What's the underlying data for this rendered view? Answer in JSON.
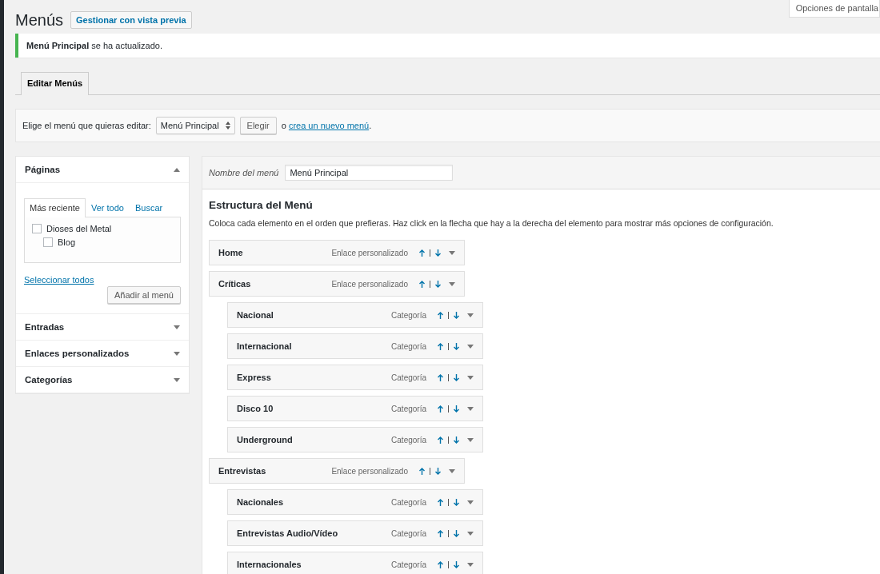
{
  "page_title": "Menús",
  "preview_button": "Gestionar con vista previa",
  "screen_options": "Opciones de pantalla",
  "notice": "**Menú Principal** se ha actualizado.",
  "tabs": [
    {
      "label": "Editar Menús",
      "selected": true
    }
  ],
  "menu_select": {
    "label": "Elige el menú que quieras editar:",
    "value": "Menú Principal",
    "button": "Elegir",
    "create_prefix": "o",
    "create_link": "crea un nuevo menú",
    "create_suffix": "."
  },
  "sidebar": {
    "panels": [
      {
        "title": "Páginas",
        "expanded": true,
        "tabs": [
          {
            "label": "Más reciente",
            "selected": true
          },
          {
            "label": "Ver todo",
            "selected": false
          },
          {
            "label": "Buscar",
            "selected": false
          }
        ],
        "items": [
          {
            "label": "Dioses del Metal",
            "checked": false,
            "children": [
              {
                "label": "Blog",
                "checked": false
              }
            ]
          }
        ],
        "select_all": "Seleccionar todos",
        "add_button": "Añadir al menú"
      },
      {
        "title": "Entradas",
        "expanded": false
      },
      {
        "title": "Enlaces personalizados",
        "expanded": false
      },
      {
        "title": "Categorías",
        "expanded": false
      }
    ]
  },
  "menu_editor": {
    "name_label": "Nombre del menú",
    "name_value": "Menú Principal",
    "heading": "Estructura del Menú",
    "description": "Coloca cada elemento en el orden que prefieras. Haz click en la flecha que hay a la derecha del elemento para mostrar más opciones de configuración.",
    "items": [
      {
        "title": "Home",
        "type": "Enlace personalizado"
      },
      {
        "title": "Críticas",
        "type": "Enlace personalizado",
        "children": [
          {
            "title": "Nacional",
            "type": "Categoría"
          },
          {
            "title": "Internacional",
            "type": "Categoría"
          },
          {
            "title": "Express",
            "type": "Categoría"
          },
          {
            "title": "Disco 10",
            "type": "Categoría"
          },
          {
            "title": "Underground",
            "type": "Categoría"
          }
        ]
      },
      {
        "title": "Entrevistas",
        "type": "Enlace personalizado",
        "children": [
          {
            "title": "Nacionales",
            "type": "Categoría"
          },
          {
            "title": "Entrevistas Audio/Vídeo",
            "type": "Categoría"
          },
          {
            "title": "Internacionales",
            "type": "Categoría"
          }
        ]
      }
    ]
  }
}
